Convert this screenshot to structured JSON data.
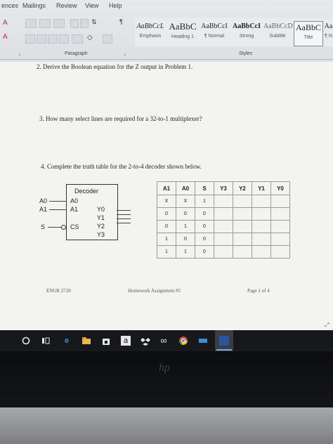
{
  "ribbon": {
    "tabs": [
      "ences",
      "Mailings",
      "Review",
      "View",
      "Help"
    ],
    "styles": [
      {
        "preview": "AaBbCcL",
        "name": "Emphasis"
      },
      {
        "preview": "AaBbC",
        "name": "Heading 1"
      },
      {
        "preview": "AaBbCcI",
        "name": "¶ Normal"
      },
      {
        "preview": "AaBbCcI",
        "name": "Strong"
      },
      {
        "preview": "AaBbCcD",
        "name": "Subtitle"
      },
      {
        "preview": "AaBbC",
        "name": "Title"
      },
      {
        "preview": "Aa",
        "name": "¶ N"
      }
    ],
    "groups": {
      "paragraph": "Paragraph",
      "styles": "Styles"
    }
  },
  "document": {
    "q2": "2.   Derive the Boolean equation for the Z output in Problem 1.",
    "q3": "3.   How many select lines are required for a 32-to-1 multiplexer?",
    "q4": "4.   Complete the truth table for the 2-to-4 decoder shown below.",
    "decoder": {
      "title": "Decoder",
      "inputs_outer": [
        "A0",
        "A1"
      ],
      "inputs_inner": [
        "A0",
        "A1"
      ],
      "select_outer": "S",
      "select_inner": "CS",
      "outputs": [
        "Y0",
        "Y1",
        "Y2",
        "Y3"
      ]
    },
    "truth_table": {
      "headers": [
        "A1",
        "A0",
        "S",
        "Y3",
        "Y2",
        "Y1",
        "Y0"
      ],
      "rows": [
        [
          "X",
          "X",
          "1",
          "",
          "",
          "",
          ""
        ],
        [
          "0",
          "0",
          "0",
          "",
          "",
          "",
          ""
        ],
        [
          "0",
          "1",
          "0",
          "",
          "",
          "",
          ""
        ],
        [
          "1",
          "0",
          "0",
          "",
          "",
          "",
          ""
        ],
        [
          "1",
          "1",
          "0",
          "",
          "",
          "",
          ""
        ]
      ]
    },
    "footer": {
      "left": "ENGR 2720",
      "center": "Homework Assignment #5",
      "right": "Page 1 of 4"
    }
  },
  "taskbar": {
    "icons": [
      "start-icon",
      "task-view-icon",
      "edge-icon",
      "file-explorer-icon",
      "store-icon",
      "amazon-icon",
      "dropbox-icon",
      "infinity-app-icon",
      "chrome-icon",
      "app-icon",
      "word-icon"
    ]
  },
  "colors": {
    "word_blue": "#2b579a",
    "taskbar": "#16181c",
    "page_bg": "#f3f4f2"
  }
}
